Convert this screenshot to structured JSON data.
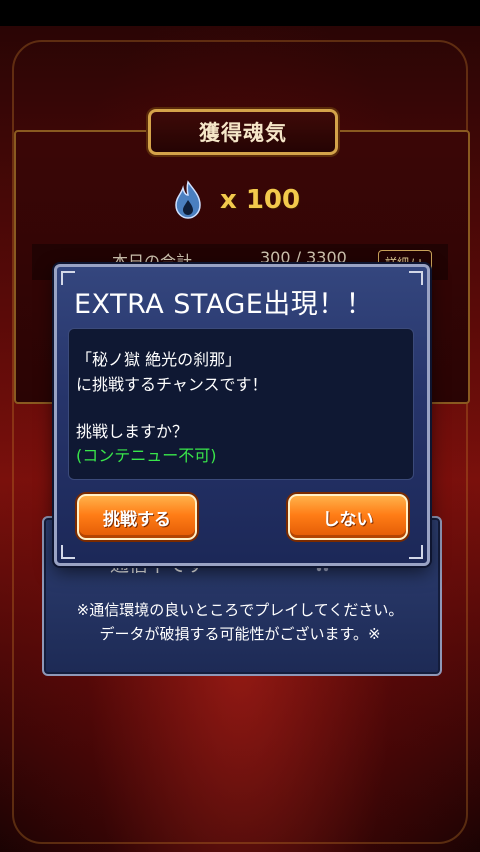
{
  "reward": {
    "title": "獲得魂気",
    "amount": "x 100",
    "today_label": "本日の合計",
    "today_value": "300 / 3300",
    "detail_label": "詳細ﾉ+"
  },
  "communication": {
    "status": "通信中です",
    "notice_line1": "※通信環境の良いところでプレイしてください。",
    "notice_line2": "データが破損する可能性がございます。※"
  },
  "modal": {
    "title": "EXTRA STAGE出現！！",
    "stage_name": "「秘ノ獄 絶光の刹那」",
    "line2": "に挑戦するチャンスです！",
    "question": "挑戦しますか？",
    "note": "(コンテニュー不可)",
    "accept_label": "挑戦する",
    "decline_label": "しない",
    "note_color": "#39e64a",
    "button_color": "#ff7d16"
  },
  "icons": {
    "soul": "blue-flame-icon",
    "spinner": "loading-spinner-icon"
  }
}
